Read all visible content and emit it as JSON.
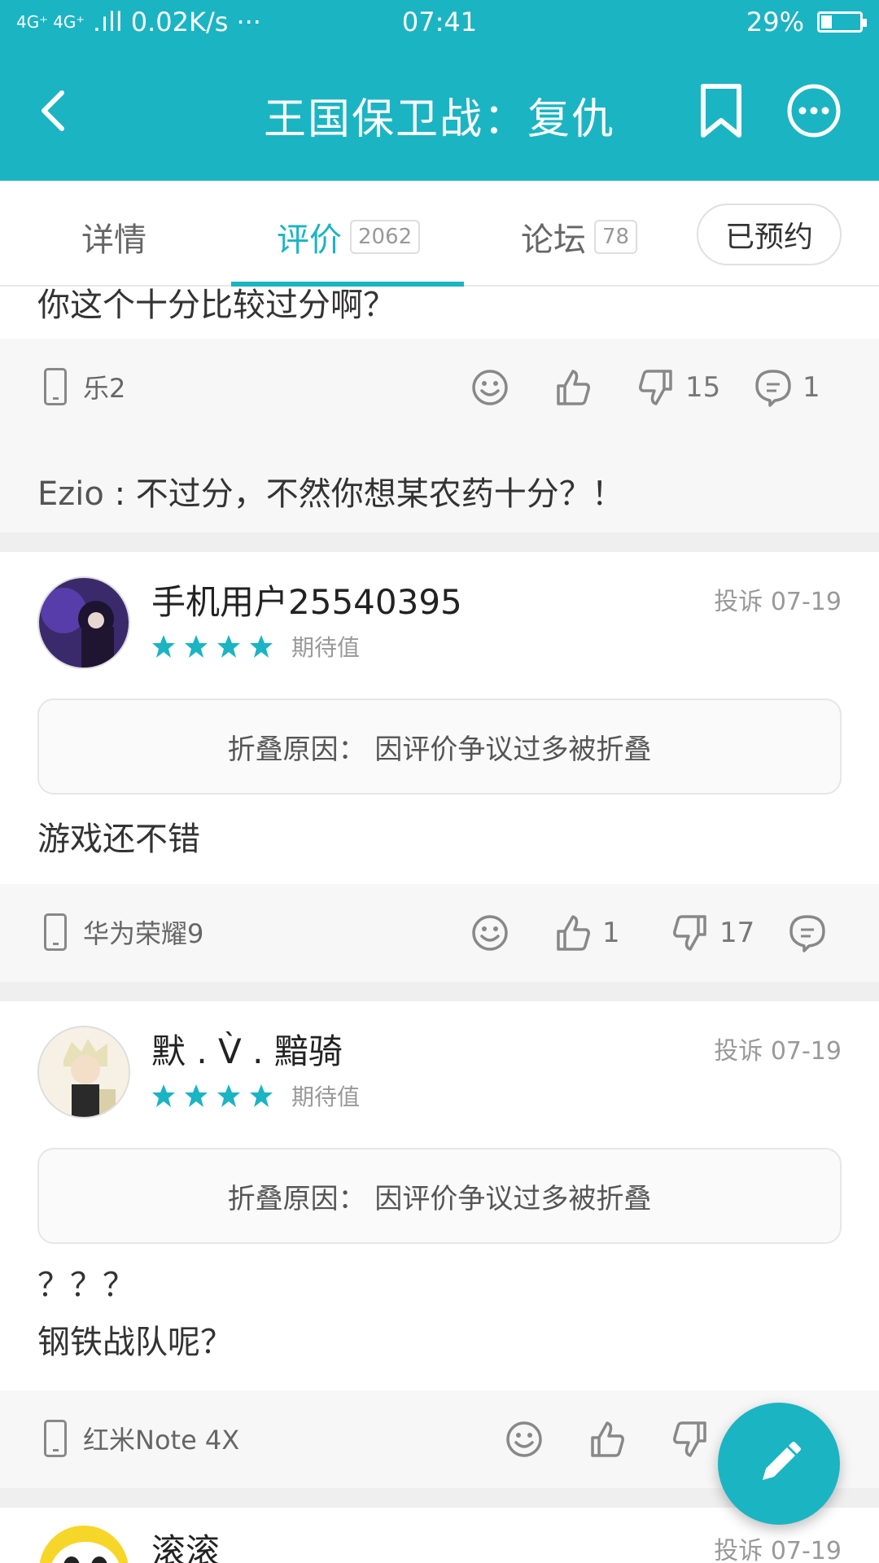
{
  "status_bar": {
    "network": "4G⁺ 4G⁺",
    "signal": ".ıll",
    "speed": "0.02K/s",
    "dots": "···",
    "time": "07:41",
    "battery_percent": "29%",
    "battery_level": 0.29
  },
  "header": {
    "title": "王国保卫战：复仇",
    "back_icon": "chevron-left-icon",
    "bookmark_icon": "bookmark-icon",
    "more_icon": "more-icon"
  },
  "tabs": [
    {
      "label": "详情",
      "count": ""
    },
    {
      "label": "评价",
      "count": "2062"
    },
    {
      "label": "论坛",
      "count": "78"
    }
  ],
  "reserve_button": "已预约",
  "top_snippet": "你这个十分比较过分啊？",
  "top_actions": {
    "device": "乐2",
    "dislikes": "15",
    "comments": "1"
  },
  "reply": {
    "author": "Ezio",
    "separator": " : ",
    "text": "不过分，不然你想某农药十分？！"
  },
  "reviews": [
    {
      "username": "手机用户25540395",
      "complaint": "投诉",
      "date": "07-19",
      "stars_label": "期待值",
      "rating": 4,
      "fold_reason": "折叠原因：  因评价争议过多被折叠",
      "body_lines": [
        "游戏还不错"
      ],
      "device": "华为荣耀9",
      "likes": "1",
      "dislikes": "17"
    },
    {
      "username": "默 . V̀ . 黯骑",
      "complaint": "投诉",
      "date": "07-19",
      "stars_label": "期待值",
      "rating": 4,
      "fold_reason": "折叠原因：  因评价争议过多被折叠",
      "body_lines": [
        "？？？",
        "钢铁战队呢？"
      ],
      "device": "红米Note 4X"
    },
    {
      "username": "滚滚",
      "complaint": "投诉",
      "date": "07-19"
    }
  ],
  "colors": {
    "accent": "#1bb4c3",
    "star": "#1bb4c3"
  }
}
